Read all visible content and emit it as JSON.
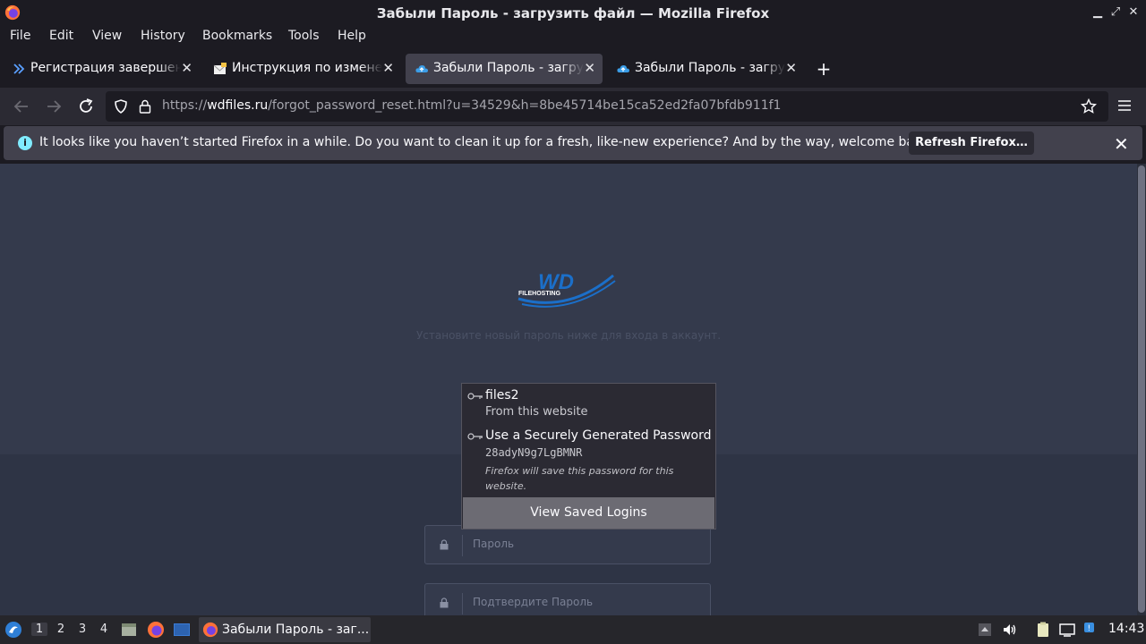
{
  "window": {
    "title": "Забыли Пароль - загрузить файл — Mozilla Firefox",
    "minimize_glyph": "▁",
    "restore_glyph": "⤢",
    "close_glyph": "✕"
  },
  "menubar": {
    "items": [
      {
        "label": "File"
      },
      {
        "label": "Edit"
      },
      {
        "label": "View"
      },
      {
        "label": "History"
      },
      {
        "label": "Bookmarks"
      },
      {
        "label": "Tools"
      },
      {
        "label": "Help"
      }
    ]
  },
  "tabs": [
    {
      "label": "Регистрация завершена",
      "icon": "double-chevron-icon",
      "active": false
    },
    {
      "label": "Инструкция по изменению",
      "icon": "mail-icon",
      "active": false
    },
    {
      "label": "Забыли Пароль - загрузить файл",
      "icon": "cloud-icon",
      "active": true
    },
    {
      "label": "Забыли Пароль - загрузить файл",
      "icon": "cloud-icon",
      "active": false
    }
  ],
  "tab_close_glyph": "✕",
  "new_tab_glyph": "+",
  "navbar": {
    "url_prefix": "https://",
    "url_host": "wdfiles.ru",
    "url_path": "/forgot_password_reset.html?u=34529&h=8be45714be15ca52ed2fa07bfdb911f1"
  },
  "notification": {
    "info_glyph": "i",
    "message": "It looks like you haven’t started Firefox in a while. Do you want to clean it up for a fresh, like-new experience? And by the way, welcome back!",
    "button": "Refresh Firefox…",
    "close_glyph": "✕"
  },
  "page": {
    "logo_text": "WD",
    "logo_subtext": "FILEHOSTING",
    "subtitle": "Установите новый пароль ниже для входа в аккаунт.",
    "password_placeholder": "Пароль",
    "confirm_placeholder": "Подтвердите Пароль"
  },
  "autocomplete": {
    "saved_login": {
      "username": "files2",
      "source": "From this website"
    },
    "generated": {
      "title": "Use a Securely Generated Password",
      "password": "28adyN9g7LgBMNR",
      "note": "Firefox will save this password for this website."
    },
    "footer": "View Saved Logins"
  },
  "taskbar": {
    "workspaces": [
      "1",
      "2",
      "3",
      "4"
    ],
    "active_workspace": "1",
    "task_label": "Забыли Пароль - заг...",
    "clock": "14:43"
  },
  "colors": {
    "content_bg": "#343a4c",
    "accent_info": "#80ebff",
    "logo_blue": "#1b6fc9"
  }
}
